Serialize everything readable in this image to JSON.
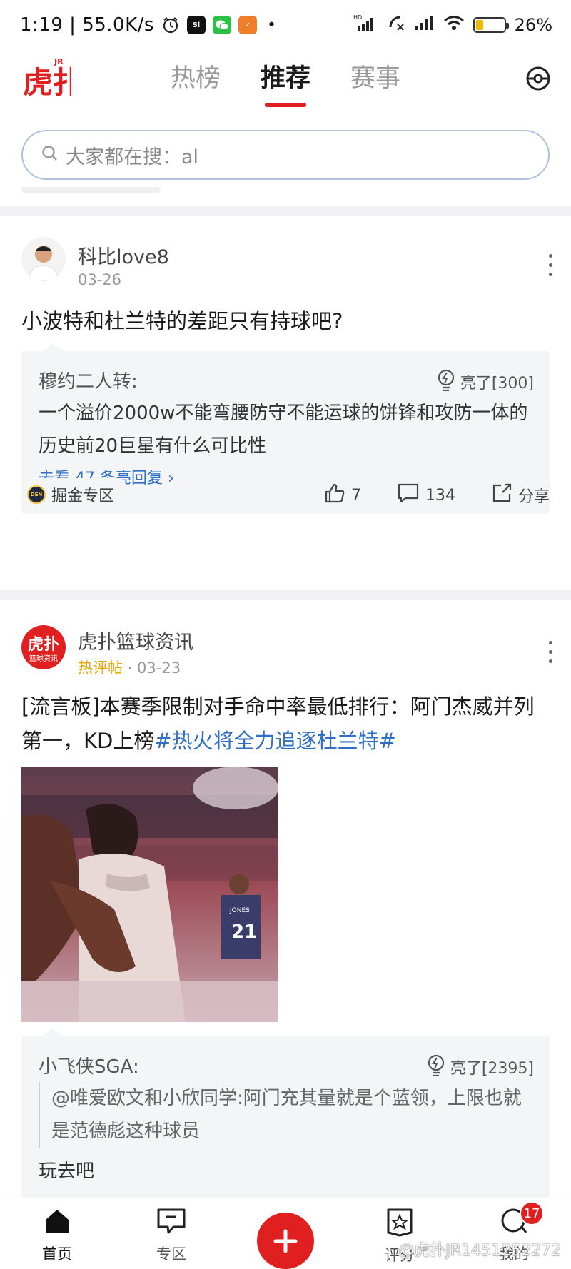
{
  "status_bar": {
    "time": "1:19",
    "speed": "55.0K/s",
    "battery": "26%",
    "battery_level": 0.26,
    "network_badge": "HD"
  },
  "header": {
    "logo_text": "虎扑",
    "logo_badge": "JR",
    "tabs": [
      {
        "label": "热榜",
        "active": false
      },
      {
        "label": "推荐",
        "active": true
      },
      {
        "label": "赛事",
        "active": false
      }
    ]
  },
  "search": {
    "placeholder": "大家都在搜：al"
  },
  "posts": [
    {
      "author": "科比love8",
      "date": "03-26",
      "title": "小波特和杜兰特的差距只有持球吧?",
      "reply": {
        "user": "穆约二人转:",
        "lit": "亮了[300]",
        "text": "一个溢价2000w不能弯腰防守不能运球的饼锋和攻防一体的历史前20巨星有什么可比性",
        "link": "去看 47 条亮回复"
      },
      "zone": "掘金专区",
      "zone_badge": "DEN",
      "likes": "7",
      "comments": "134",
      "share": "分享"
    },
    {
      "author": "虎扑篮球资讯",
      "avatar_text": "虎扑",
      "avatar_sub": "篮球资讯",
      "hot_tag": "热评帖",
      "date": "03-23",
      "title_main": "[流言板]本赛季限制对手命中率最低排行：阿门杰威并列第一，KD上榜",
      "title_topic": "#热火将全力追逐杜兰特#",
      "image_jersey": "21",
      "image_name": "JONES",
      "reply": {
        "user": "小飞侠SGA:",
        "lit": "亮了[2395]",
        "quote": "@唯爱欧文和小欣同学:阿门充其量就是个蓝领，上限也就是范德彪这种球员",
        "text": "玩去吧"
      }
    }
  ],
  "bottom_nav": [
    {
      "label": "首页",
      "active": true
    },
    {
      "label": "专区",
      "active": false
    },
    {
      "label": "",
      "active": false
    },
    {
      "label": "评分",
      "active": false
    },
    {
      "label": "我的",
      "active": false
    }
  ],
  "notification_count": "17",
  "watermark": "@虎扑JR1451252272"
}
